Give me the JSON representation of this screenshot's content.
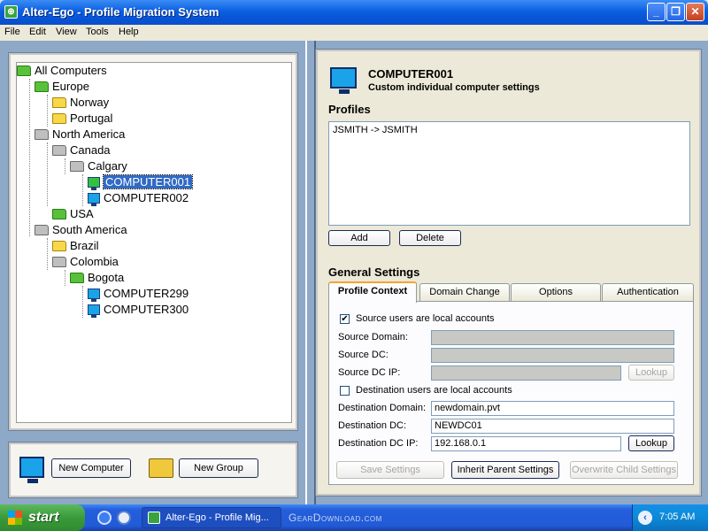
{
  "window": {
    "title": "Alter-Ego - Profile Migration System"
  },
  "menu": [
    "File",
    "Edit",
    "View",
    "Tools",
    "Help"
  ],
  "tree": {
    "nodes": [
      {
        "label": "All Computers",
        "icon": "folder-open-green-icon"
      },
      {
        "label": "Europe",
        "icon": "folder-open-green-icon"
      },
      {
        "label": "Norway",
        "icon": "folder-yellow-icon"
      },
      {
        "label": "Portugal",
        "icon": "folder-yellow-icon"
      },
      {
        "label": "North America",
        "icon": "folder-open-grey-icon"
      },
      {
        "label": "Canada",
        "icon": "folder-open-grey-icon"
      },
      {
        "label": "Calgary",
        "icon": "folder-open-grey-icon"
      },
      {
        "label": "COMPUTER001",
        "icon": "computer-green-icon",
        "selected": true
      },
      {
        "label": "COMPUTER002",
        "icon": "computer-icon"
      },
      {
        "label": "USA",
        "icon": "folder-green-icon"
      },
      {
        "label": "South America",
        "icon": "folder-open-grey-icon"
      },
      {
        "label": "Brazil",
        "icon": "folder-yellow-icon"
      },
      {
        "label": "Colombia",
        "icon": "folder-open-grey-icon"
      },
      {
        "label": "Bogota",
        "icon": "folder-open-green-icon"
      },
      {
        "label": "COMPUTER299",
        "icon": "computer-icon"
      },
      {
        "label": "COMPUTER300",
        "icon": "computer-icon"
      }
    ]
  },
  "actions": {
    "new_computer": "New Computer",
    "new_group": "New Group"
  },
  "details": {
    "computer_name": "COMPUTER001",
    "subtitle": "Custom individual computer settings",
    "profiles_heading": "Profiles",
    "profiles": [
      "JSMITH -> JSMITH"
    ],
    "add": "Add",
    "delete": "Delete",
    "general_heading": "General Settings"
  },
  "tabs": [
    "Profile Context",
    "Domain Change",
    "Options",
    "Authentication"
  ],
  "active_tab": "Profile Context",
  "profile_context": {
    "source_local_label": "Source users are local accounts",
    "source_local_checked": true,
    "source_domain_label": "Source Domain:",
    "source_domain_value": "",
    "source_dc_label": "Source DC:",
    "source_dc_value": "",
    "source_dc_ip_label": "Source DC IP:",
    "source_dc_ip_value": "",
    "lookup": "Lookup",
    "dest_local_label": "Destination users are local accounts",
    "dest_local_checked": false,
    "dest_domain_label": "Destination Domain:",
    "dest_domain_value": "newdomain.pvt",
    "dest_dc_label": "Destination DC:",
    "dest_dc_value": "NEWDC01",
    "dest_dc_ip_label": "Destination DC IP:",
    "dest_dc_ip_value": "192.168.0.1",
    "save_settings": "Save Settings",
    "inherit_parent": "Inherit Parent Settings",
    "overwrite_child": "Overwrite Child Settings"
  },
  "taskbar": {
    "start": "start",
    "task_button": "Alter-Ego - Profile Mig...",
    "clock": "7:05 AM",
    "watermark": "GearDownload.com"
  },
  "colors": {
    "titlebar": "#0a5fe0",
    "workspace": "#8ea8c8",
    "selection": "#316ac5",
    "tab_accent": "#f5a52f"
  }
}
